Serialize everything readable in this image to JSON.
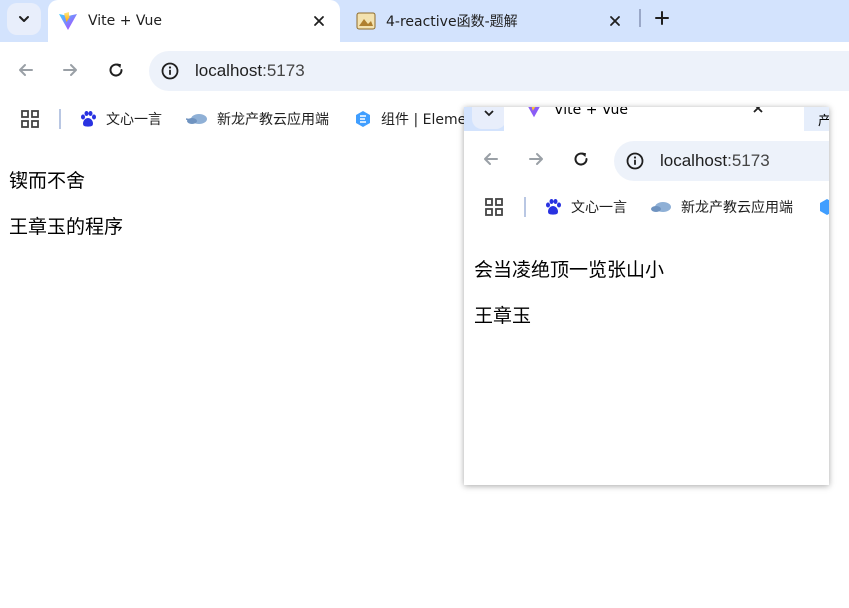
{
  "browser": {
    "tabs": [
      {
        "title": "Vite + Vue",
        "active": true,
        "favicon": "vite-icon"
      },
      {
        "title": "4-reactive函数-题解",
        "active": false,
        "favicon": "image-icon"
      }
    ],
    "url": {
      "host": "localhost",
      "port": ":5173"
    },
    "bookmarks": [
      {
        "label": "文心一言",
        "icon": "baidu-paw-icon"
      },
      {
        "label": "新龙产教云应用端",
        "icon": "cloud-icon"
      },
      {
        "label": "组件 | Eleme",
        "icon": "element-hex-icon"
      }
    ]
  },
  "main_page": {
    "line1": "锲而不舍",
    "line2": "王章玉的程序"
  },
  "popup": {
    "tab_title": "Vite + Vue",
    "second_tab_fragment": "产",
    "url": {
      "host": "localhost",
      "port": ":5173"
    },
    "bookmarks": [
      {
        "label": "文心一言"
      },
      {
        "label": "新龙产教云应用端"
      }
    ],
    "line1": "会当凌绝顶一览张山小",
    "line2": "王章玉"
  },
  "colors": {
    "tabstrip": "#d3e3fd",
    "omnibox": "#edf2fa",
    "accent": "#1a73e8"
  }
}
